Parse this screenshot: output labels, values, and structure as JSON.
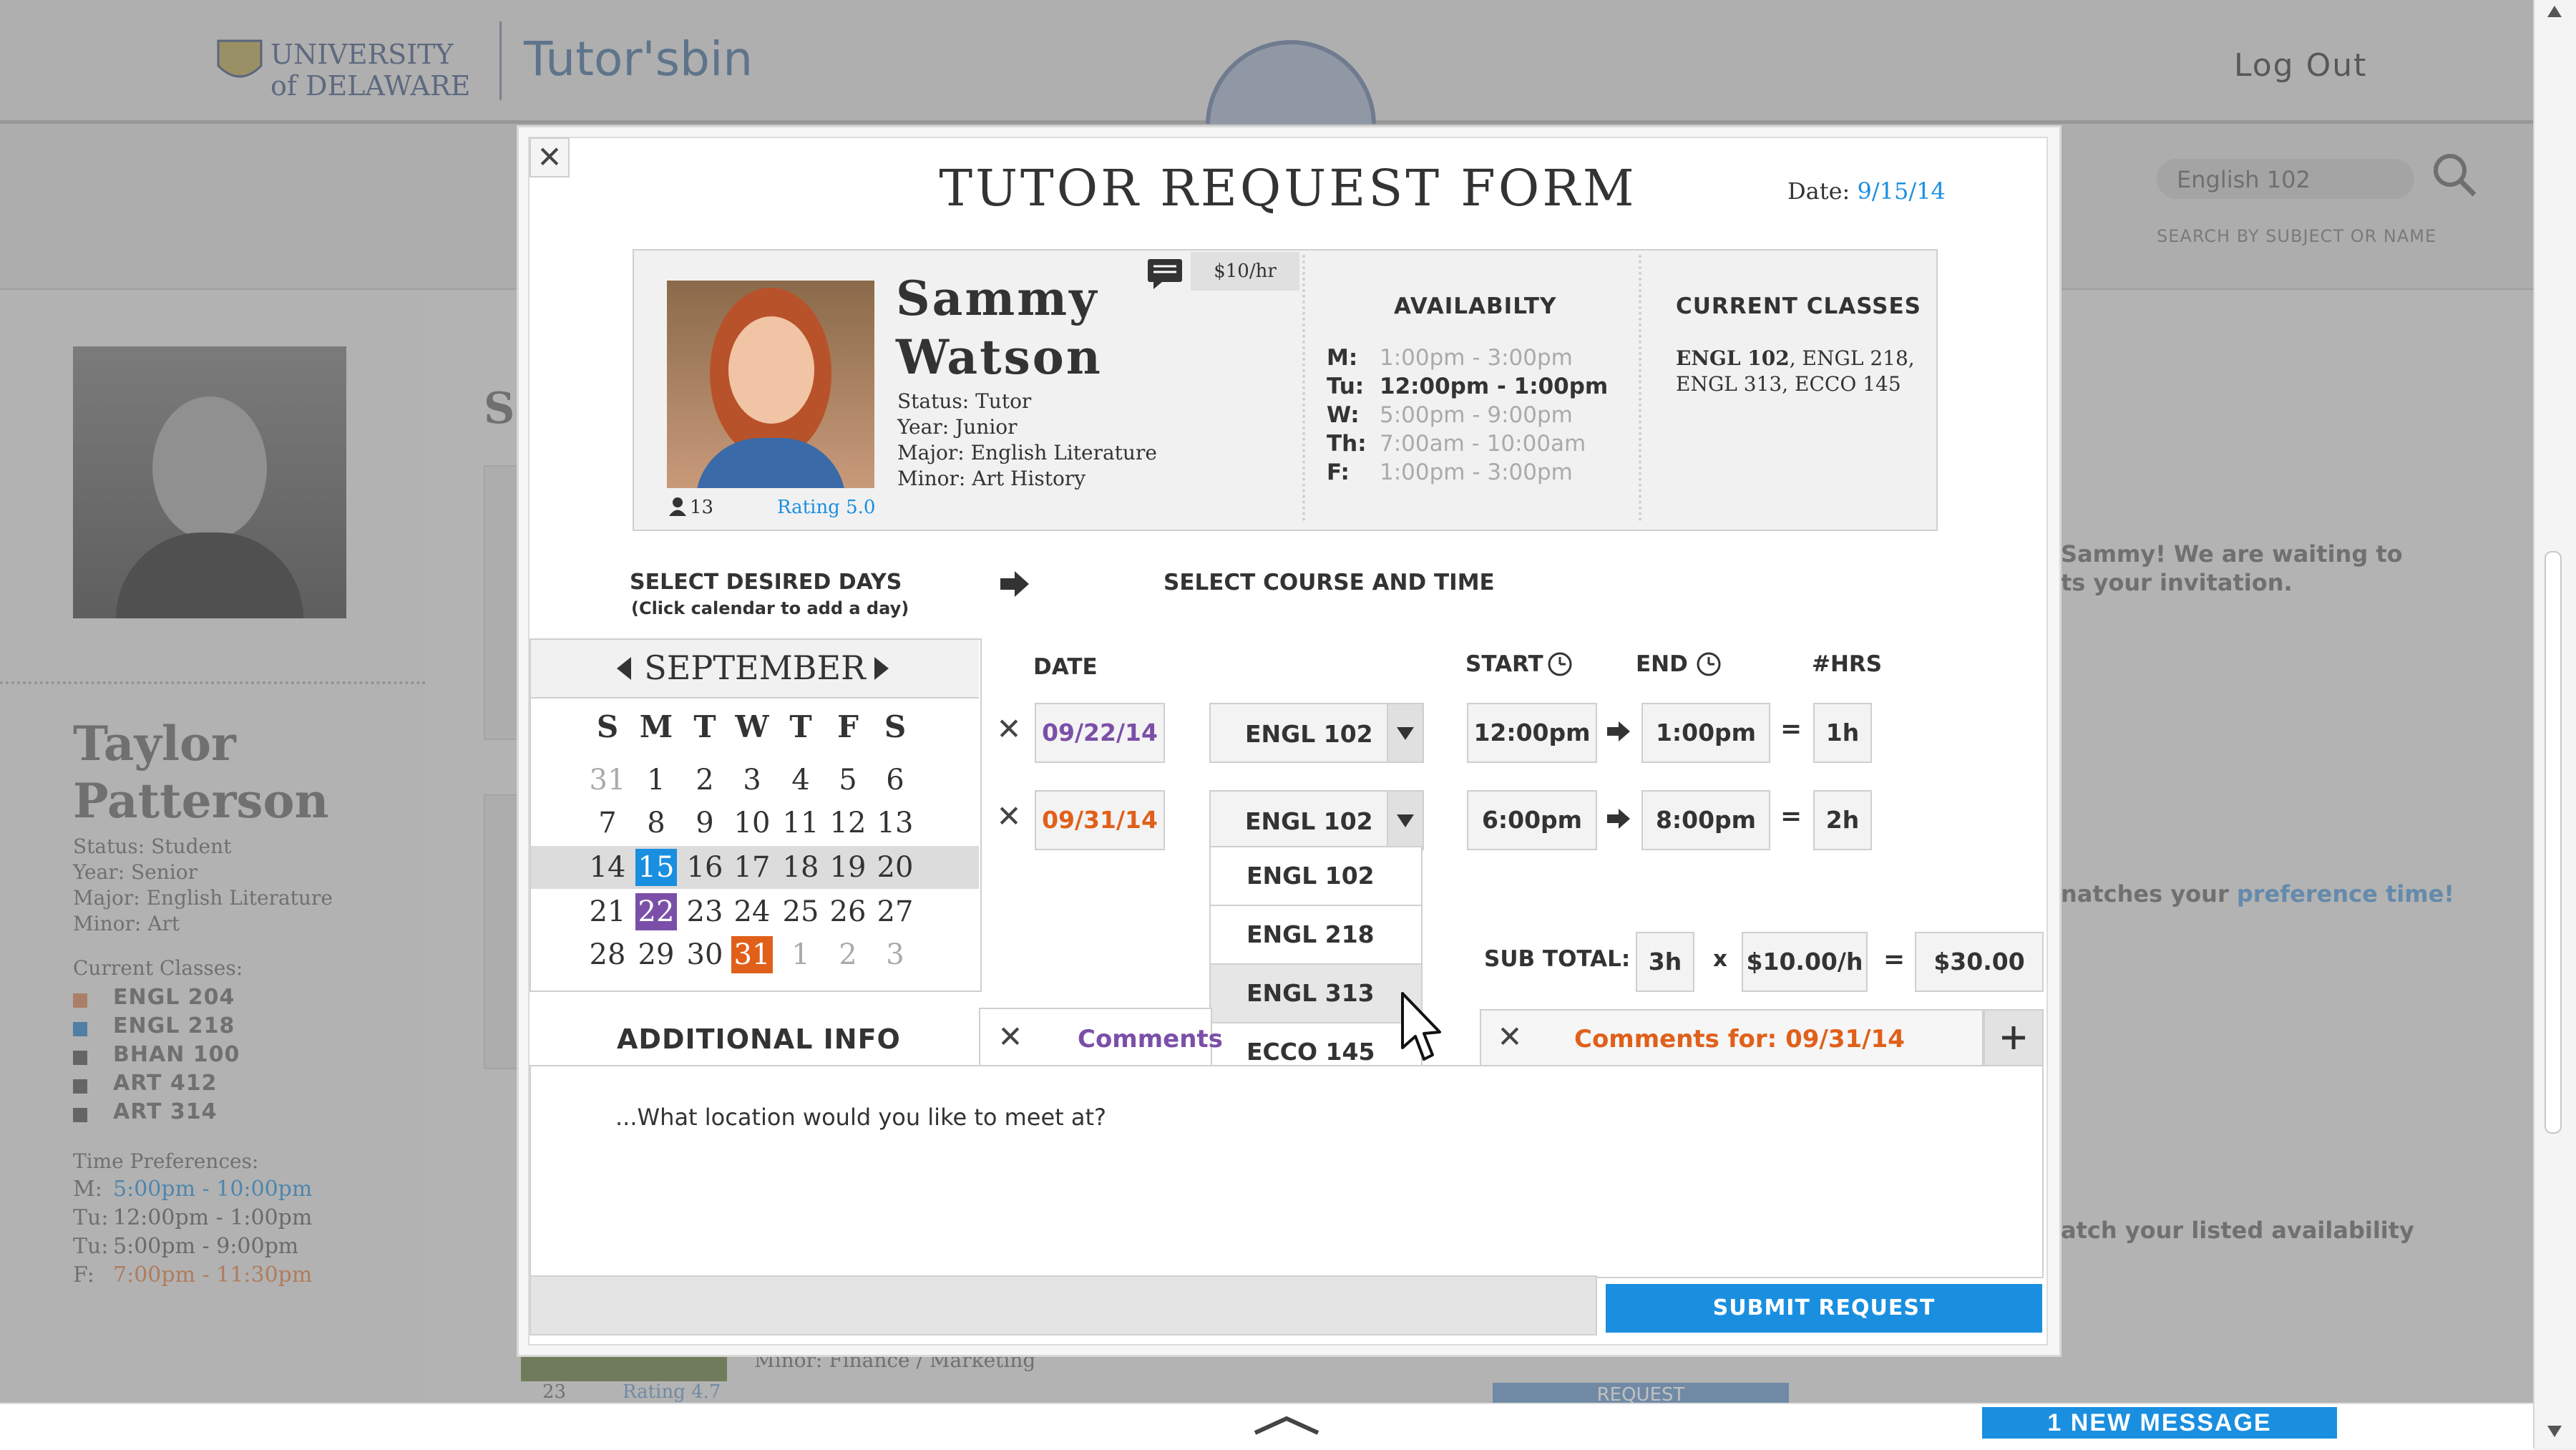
{
  "header": {
    "university_logo_text": "UNIVERSITY of DELAWARE",
    "app_logo_text": "Tutor'sbin",
    "logout_label": "Log Out",
    "search_value": "English 102",
    "search_hint": "SEARCH BY SUBJECT OR NAME"
  },
  "profile": {
    "name_first": "Taylor",
    "name_last": "Patterson",
    "status": "Status: Student",
    "year": "Year: Senior",
    "major": "Major: English Literature",
    "minor": "Minor: Art",
    "classes_title": "Current Classes:",
    "classes": [
      "ENGL 204",
      "ENGL 218",
      "BHAN 100",
      "ART 412",
      "ART 314"
    ],
    "class_colors": [
      "#e0a07c",
      "#5aa0d8",
      "#7a7a7a",
      "#7a7a7a",
      "#7a7a7a"
    ],
    "time_title": "Time Preferences:",
    "times": [
      {
        "day": "M:",
        "time": "5:00pm - 10:00pm",
        "color": "#1a8fe0"
      },
      {
        "day": "Tu:",
        "time": "12:00pm - 1:00pm",
        "color": "#555555"
      },
      {
        "day": "Tu:",
        "time": "5:00pm - 9:00pm",
        "color": "#555555"
      },
      {
        "day": "F:",
        "time": "7:00pm - 11:30pm",
        "color": "#e87a3a"
      }
    ]
  },
  "background": {
    "msg1_line1": "Sammy! We are waiting to",
    "msg1_line2": "ts your invitation.",
    "msg2_prefix": "natches your ",
    "msg2_link": "preference time!",
    "msg3": "atch your listed availability",
    "card_minor": "Minor: Finance / Marketing",
    "card_count": "23",
    "card_rating": "Rating 4.7",
    "card_request": "REQUEST",
    "section_letter": "S"
  },
  "bottom": {
    "new_message": "1 NEW MESSAGE"
  },
  "modal": {
    "title": "TUTOR REQUEST FORM",
    "date_label": "Date:",
    "date_value": "9/15/14",
    "tutor": {
      "first": "Sammy",
      "last": "Watson",
      "status": "Status: Tutor",
      "year": "Year: Junior",
      "major": "Major: English Literature",
      "minor": "Minor: Art History",
      "count": "13",
      "rating": "Rating 5.0",
      "rate": "$10/hr"
    },
    "availability": {
      "title": "AVAILABILTY",
      "rows": [
        {
          "day": "M:",
          "time": "1:00pm - 3:00pm",
          "highlight": false
        },
        {
          "day": "Tu:",
          "time": "12:00pm - 1:00pm",
          "highlight": true
        },
        {
          "day": "W:",
          "time": "5:00pm - 9:00pm",
          "highlight": false
        },
        {
          "day": "Th:",
          "time": "7:00am - 10:00am",
          "highlight": false
        },
        {
          "day": "F:",
          "time": "1:00pm - 3:00pm",
          "highlight": false
        }
      ]
    },
    "current_classes": {
      "title": "CURRENT CLASSES",
      "line1_bold": "ENGL 102",
      "line1_rest": ", ENGL 218,",
      "line2": "ENGL 313, ECCO 145"
    },
    "select_days_title": "SELECT DESIRED DAYS",
    "select_days_hint": "(Click calendar to add a day)",
    "select_course_title": "SELECT COURSE AND TIME",
    "calendar": {
      "month": "SEPTEMBER",
      "weekdays": [
        "S",
        "M",
        "T",
        "W",
        "T",
        "F",
        "S"
      ],
      "weeks": [
        [
          "31",
          "1",
          "2",
          "3",
          "4",
          "5",
          "6"
        ],
        [
          "7",
          "8",
          "9",
          "10",
          "11",
          "12",
          "13"
        ],
        [
          "14",
          "15",
          "16",
          "17",
          "18",
          "19",
          "20"
        ],
        [
          "21",
          "22",
          "23",
          "24",
          "25",
          "26",
          "27"
        ],
        [
          "28",
          "29",
          "30",
          "31",
          "1",
          "2",
          "3"
        ]
      ]
    },
    "table_headers": {
      "date": "DATE",
      "start": "START",
      "end": "END",
      "hrs": "#HRS"
    },
    "rows": [
      {
        "date": "09/22/14",
        "course": "ENGL 102",
        "start": "12:00pm",
        "end": "1:00pm",
        "hrs": "1h",
        "date_color": "#7b4fa8"
      },
      {
        "date": "09/31/14",
        "course": "ENGL 102",
        "start": "6:00pm",
        "end": "8:00pm",
        "hrs": "2h",
        "date_color": "#e0601a"
      }
    ],
    "course_options": [
      "ENGL 102",
      "ENGL 218",
      "ENGL 313",
      "ECCO 145"
    ],
    "subtotal": {
      "label": "SUB TOTAL:",
      "hours": "3h",
      "times": "x",
      "rate": "$10.00/h",
      "equals": "=",
      "total": "$30.00"
    },
    "additional_info_title": "ADDITIONAL INFO",
    "comment_tabs": [
      {
        "label": "Comments",
        "color": "#7b4fa8"
      },
      {
        "label": "Comments for: 09/31/14",
        "color": "#e0601a"
      }
    ],
    "comment_text": "...What location would you like to meet at?",
    "submit_label": "SUBMIT REQUEST"
  },
  "colors": {
    "accent_blue": "#1a8fe0",
    "purple": "#7b4fa8",
    "orange": "#e0601a"
  }
}
